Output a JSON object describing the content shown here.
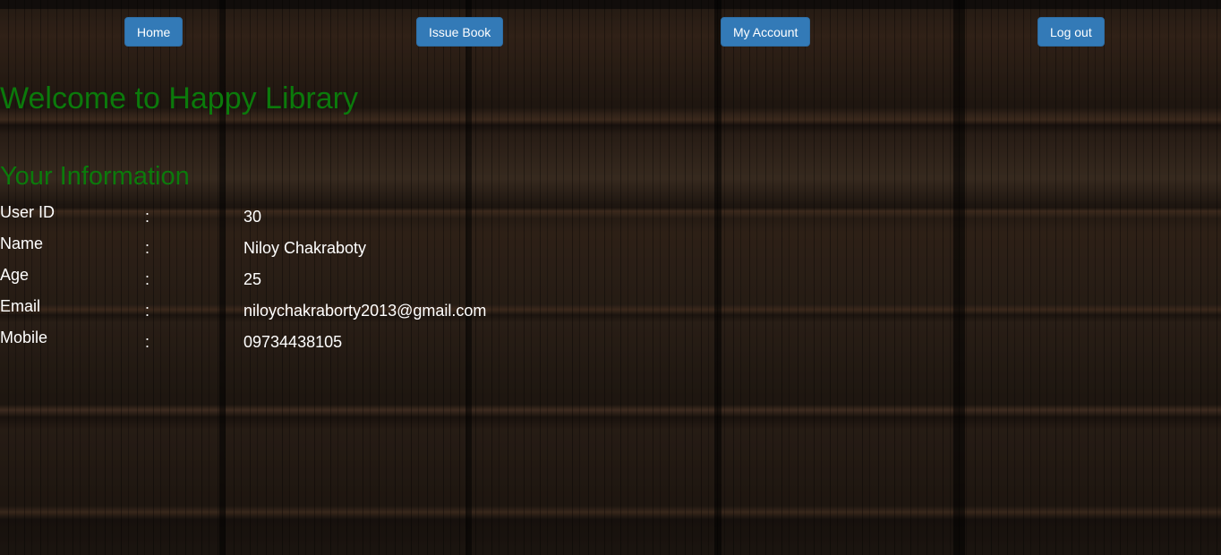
{
  "nav": {
    "home": "Home",
    "issue_book": "Issue Book",
    "my_account": "My Account",
    "log_out": "Log out"
  },
  "header": {
    "welcome": "Welcome to Happy Library"
  },
  "info": {
    "title": "Your Information",
    "separator": ":",
    "rows": [
      {
        "label": "User ID",
        "value": "30"
      },
      {
        "label": "Name",
        "value": "Niloy Chakraboty"
      },
      {
        "label": "Age",
        "value": "25"
      },
      {
        "label": "Email",
        "value": "niloychakraborty2013@gmail.com"
      },
      {
        "label": "Mobile",
        "value": "09734438105"
      }
    ]
  },
  "colors": {
    "button": "#337ab7",
    "heading": "#0b7a0b",
    "text": "#ffffff"
  }
}
